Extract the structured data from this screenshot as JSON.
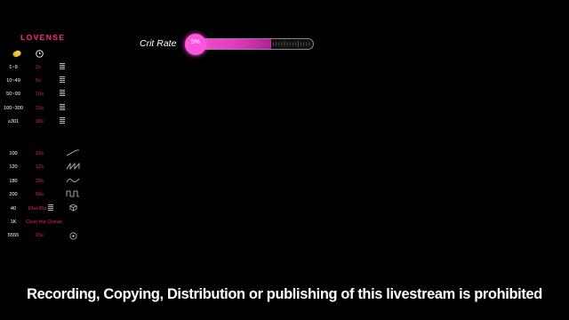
{
  "brand": "LOVENSE",
  "header_icons": [
    "coin-icon",
    "clock-icon"
  ],
  "tip_levels": [
    {
      "amount": "1~9",
      "duration": "2s",
      "icon": "bars-icon"
    },
    {
      "amount": "10~49",
      "duration": "5s",
      "icon": "bars-icon"
    },
    {
      "amount": "50~99",
      "duration": "10s",
      "icon": "bars-icon"
    },
    {
      "amount": "100~300",
      "duration": "15s",
      "icon": "bars-icon"
    },
    {
      "amount": "≥301",
      "duration": "30s",
      "icon": "bars-icon"
    }
  ],
  "special_tips": [
    {
      "amount": "100",
      "duration": "15s",
      "icon": "ramp-wave-icon"
    },
    {
      "amount": "120",
      "duration": "12s",
      "icon": "sawtooth-wave-icon"
    },
    {
      "amount": "180",
      "duration": "20s",
      "icon": "sine-wave-icon"
    },
    {
      "amount": "200",
      "duration": "60s",
      "icon": "square-wave-icon"
    },
    {
      "amount": "40",
      "duration": "10s+30s",
      "icon": "bars-icon",
      "icon2": "cube-icon"
    },
    {
      "amount": "1K",
      "duration": "Clear the Queue",
      "icon": ""
    },
    {
      "amount": "5555",
      "duration": "15s",
      "icon": "target-icon"
    }
  ],
  "crit": {
    "label": "Crit Rate",
    "value_text": "5%",
    "fill_fraction": 0.66
  },
  "footer": "Recording, Copying, Distribution or publishing of this livestream is prohibited",
  "colors": {
    "accent": "#ff2d8a",
    "duration": "#e0207a",
    "crit_fill": "#ee33c8"
  }
}
